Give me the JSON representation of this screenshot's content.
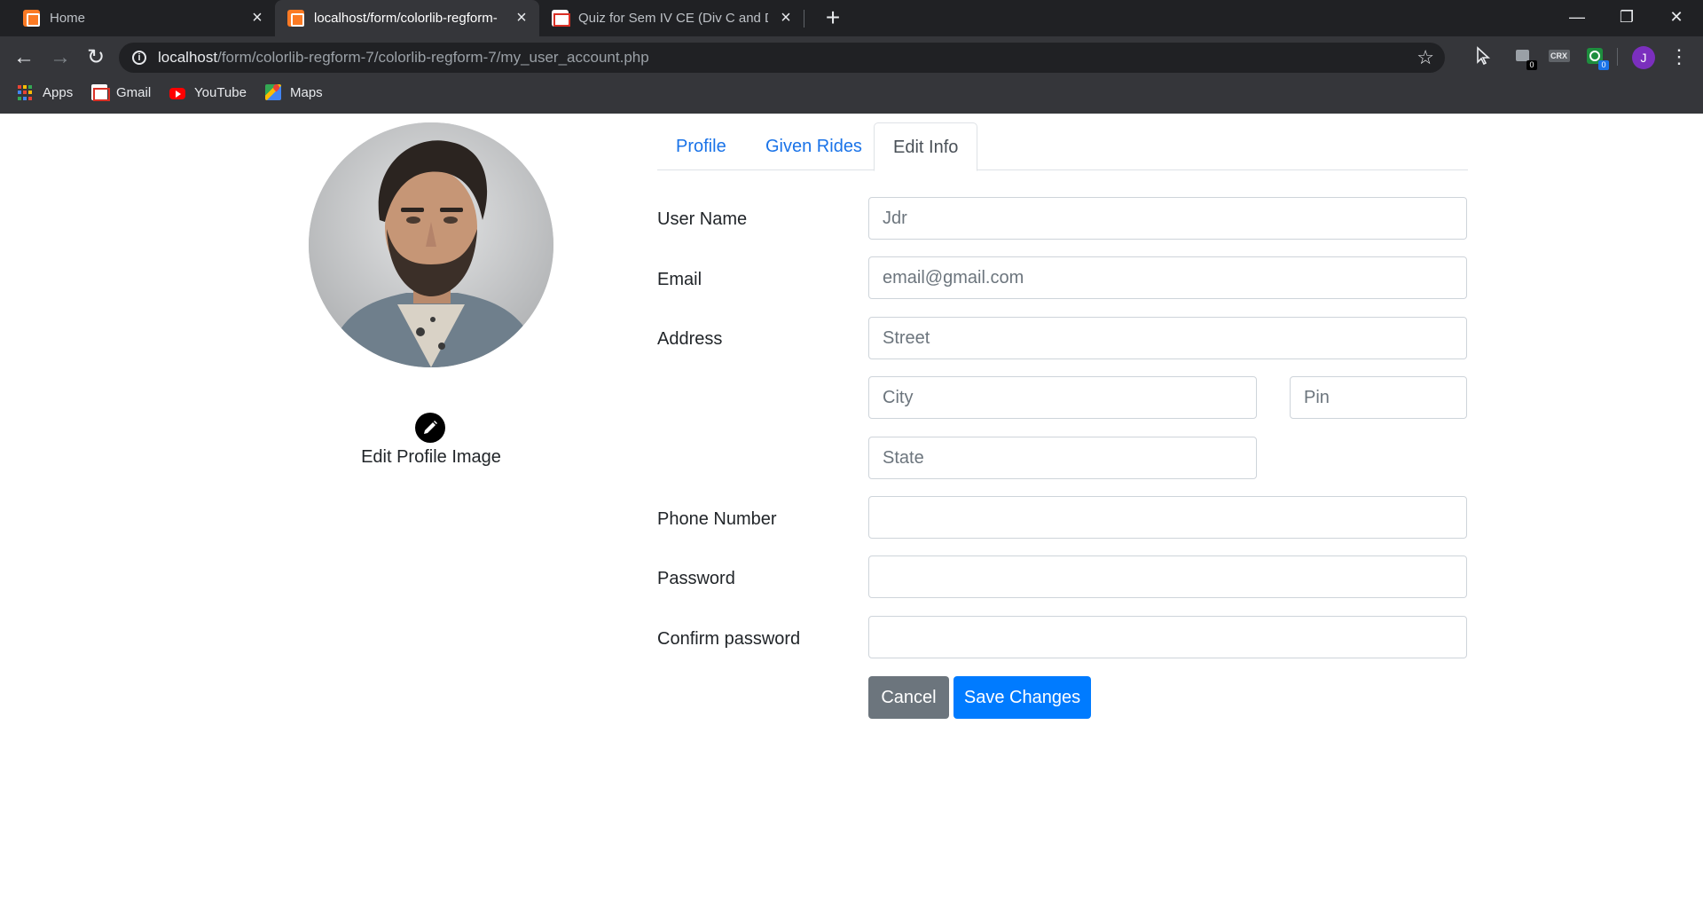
{
  "browser": {
    "tabs": [
      {
        "title": "Home",
        "icon": "xampp-icon",
        "active": false
      },
      {
        "title": "localhost/form/colorlib-regform-",
        "icon": "xampp-icon",
        "active": true
      },
      {
        "title": "Quiz for Sem IV CE (Div C and D)",
        "icon": "gmail-icon",
        "active": false
      }
    ],
    "url": {
      "host": "localhost",
      "path": "/form/colorlib-regform-7/colorlib-regform-7/my_user_account.php"
    },
    "extensions": [
      {
        "name": "cursor-extension-icon"
      },
      {
        "name": "tab-counter-extension-icon",
        "badge": "0"
      },
      {
        "name": "crx-extension-icon",
        "text": "CRX"
      },
      {
        "name": "screen-capture-extension-icon",
        "badge": "0"
      }
    ],
    "profile_initial": "J",
    "bookmarks": [
      {
        "label": "Apps",
        "icon": "apps-grid-icon"
      },
      {
        "label": "Gmail",
        "icon": "gmail-icon"
      },
      {
        "label": "YouTube",
        "icon": "youtube-icon"
      },
      {
        "label": "Maps",
        "icon": "maps-icon"
      }
    ]
  },
  "profile": {
    "edit_image_label": "Edit Profile Image"
  },
  "nav_tabs": [
    {
      "label": "Profile",
      "active": false
    },
    {
      "label": "Given Rides",
      "active": false
    },
    {
      "label": "Edit Info",
      "active": true
    }
  ],
  "form": {
    "user_name_label": "User Name",
    "user_name_placeholder": "Jdr",
    "email_label": "Email",
    "email_placeholder": "email@gmail.com",
    "address_label": "Address",
    "street_placeholder": "Street",
    "city_placeholder": "City",
    "pin_placeholder": "Pin",
    "state_placeholder": "State",
    "phone_label": "Phone Number",
    "phone_value": "",
    "password_label": "Password",
    "password_value": "",
    "confirm_password_label": "Confirm password",
    "confirm_password_value": "",
    "cancel_label": "Cancel",
    "save_label": "Save Changes"
  },
  "colors": {
    "link": "#1a73e8",
    "primary_button": "#007bff",
    "secondary_button": "#6c757d",
    "chrome_dark": "#202124",
    "chrome_toolbar": "#35363a"
  }
}
